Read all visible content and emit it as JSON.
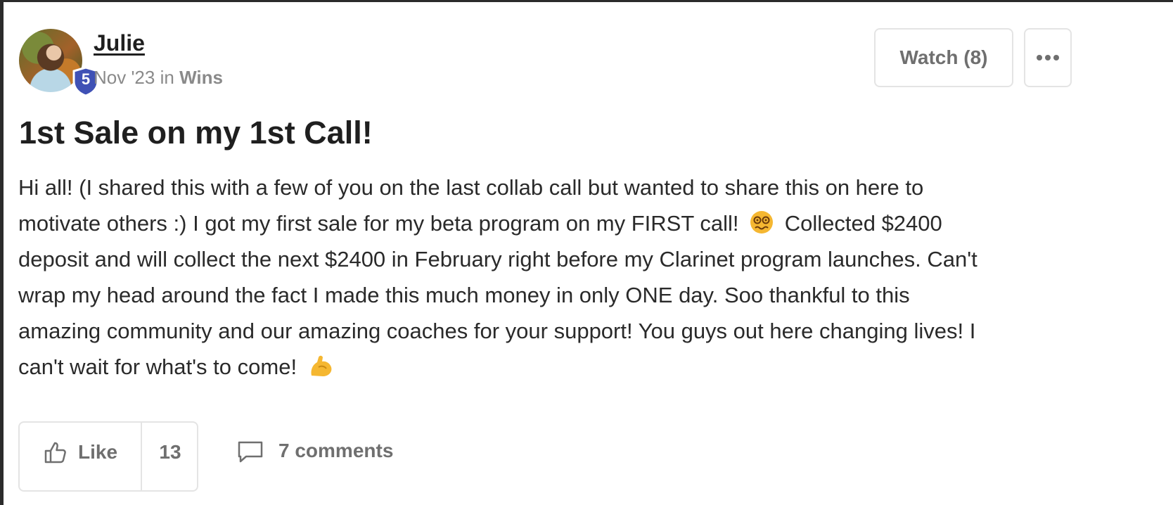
{
  "post": {
    "author": "Julie",
    "level": "5",
    "date": "Nov '23",
    "in_label": "in",
    "category": "Wins",
    "title": "1st Sale on my 1st Call!",
    "body_lines": [
      "Hi all! (I shared this with a few of you on the last collab call but wanted to share this on here to",
      "motivate others :) I got my first sale for my beta program on my FIRST call!",
      "Collected $2400",
      "deposit and will collect the next $2400 in February right before my Clarinet program launches. Can't",
      "wrap my head around the fact I made this much money in only ONE day. Soo thankful to this",
      "amazing community and our amazing coaches for your support! You guys out here changing lives! I",
      "can't wait for what's to come!"
    ],
    "emojis": [
      "woozy-face-icon",
      "flexed-biceps-icon"
    ]
  },
  "header_actions": {
    "watch_label": "Watch (8)",
    "more_icon": "more-dots-icon"
  },
  "footer": {
    "like_label": "Like",
    "like_count": "13",
    "comments_label": "7 comments"
  },
  "colors": {
    "badge": "#3f51b5",
    "muted": "#8a8a8a",
    "border": "#e4e4e4",
    "emoji": "#f5b731"
  }
}
